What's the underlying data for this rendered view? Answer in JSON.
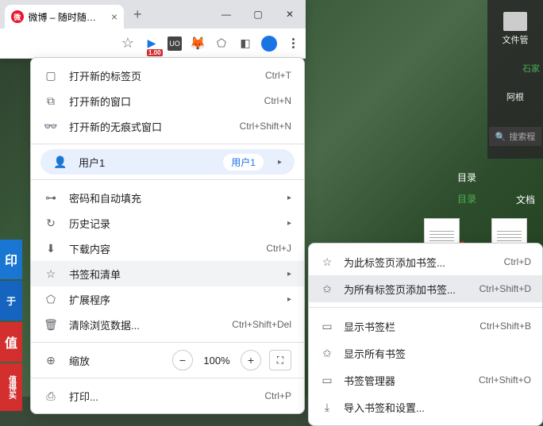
{
  "tab": {
    "title": "微博 – 随时随地发",
    "close": "×",
    "new": "+"
  },
  "window_controls": {
    "min": "—",
    "max": "▢",
    "close": "✕"
  },
  "toolbar": {
    "badge": "1.00",
    "shield": "UO"
  },
  "menu": {
    "new_tab": {
      "label": "打开新的标签页",
      "shortcut": "Ctrl+T"
    },
    "new_window": {
      "label": "打开新的窗口",
      "shortcut": "Ctrl+N"
    },
    "incognito": {
      "label": "打开新的无痕式窗口",
      "shortcut": "Ctrl+Shift+N"
    },
    "user": {
      "label": "用户1",
      "pill": "用户1"
    },
    "passwords": {
      "label": "密码和自动填充"
    },
    "history": {
      "label": "历史记录"
    },
    "downloads": {
      "label": "下载内容",
      "shortcut": "Ctrl+J"
    },
    "bookmarks": {
      "label": "书签和清单"
    },
    "extensions": {
      "label": "扩展程序"
    },
    "clear_data": {
      "label": "清除浏览数据...",
      "shortcut": "Ctrl+Shift+Del"
    },
    "zoom": {
      "label": "缩放",
      "pct": "100%"
    },
    "print": {
      "label": "打印...",
      "shortcut": "Ctrl+P"
    }
  },
  "submenu": {
    "add_bookmark": {
      "label": "为此标签页添加书签...",
      "shortcut": "Ctrl+D"
    },
    "add_all": {
      "label": "为所有标签页添加书签...",
      "shortcut": "Ctrl+Shift+D"
    },
    "show_bar": {
      "label": "显示书签栏",
      "shortcut": "Ctrl+Shift+B"
    },
    "show_all": {
      "label": "显示所有书签"
    },
    "manager": {
      "label": "书签管理器",
      "shortcut": "Ctrl+Shift+O"
    },
    "import": {
      "label": "导入书签和设置..."
    }
  },
  "desktop": {
    "file_mgr": "文件管",
    "agen": "阿根",
    "search": "搜索程",
    "mulu_title": "目录",
    "mulu": "目录",
    "wendang": "文档"
  },
  "sidebar": {
    "yin": "印",
    "yu": "于",
    "zhi": "值",
    "text": "值得买"
  }
}
